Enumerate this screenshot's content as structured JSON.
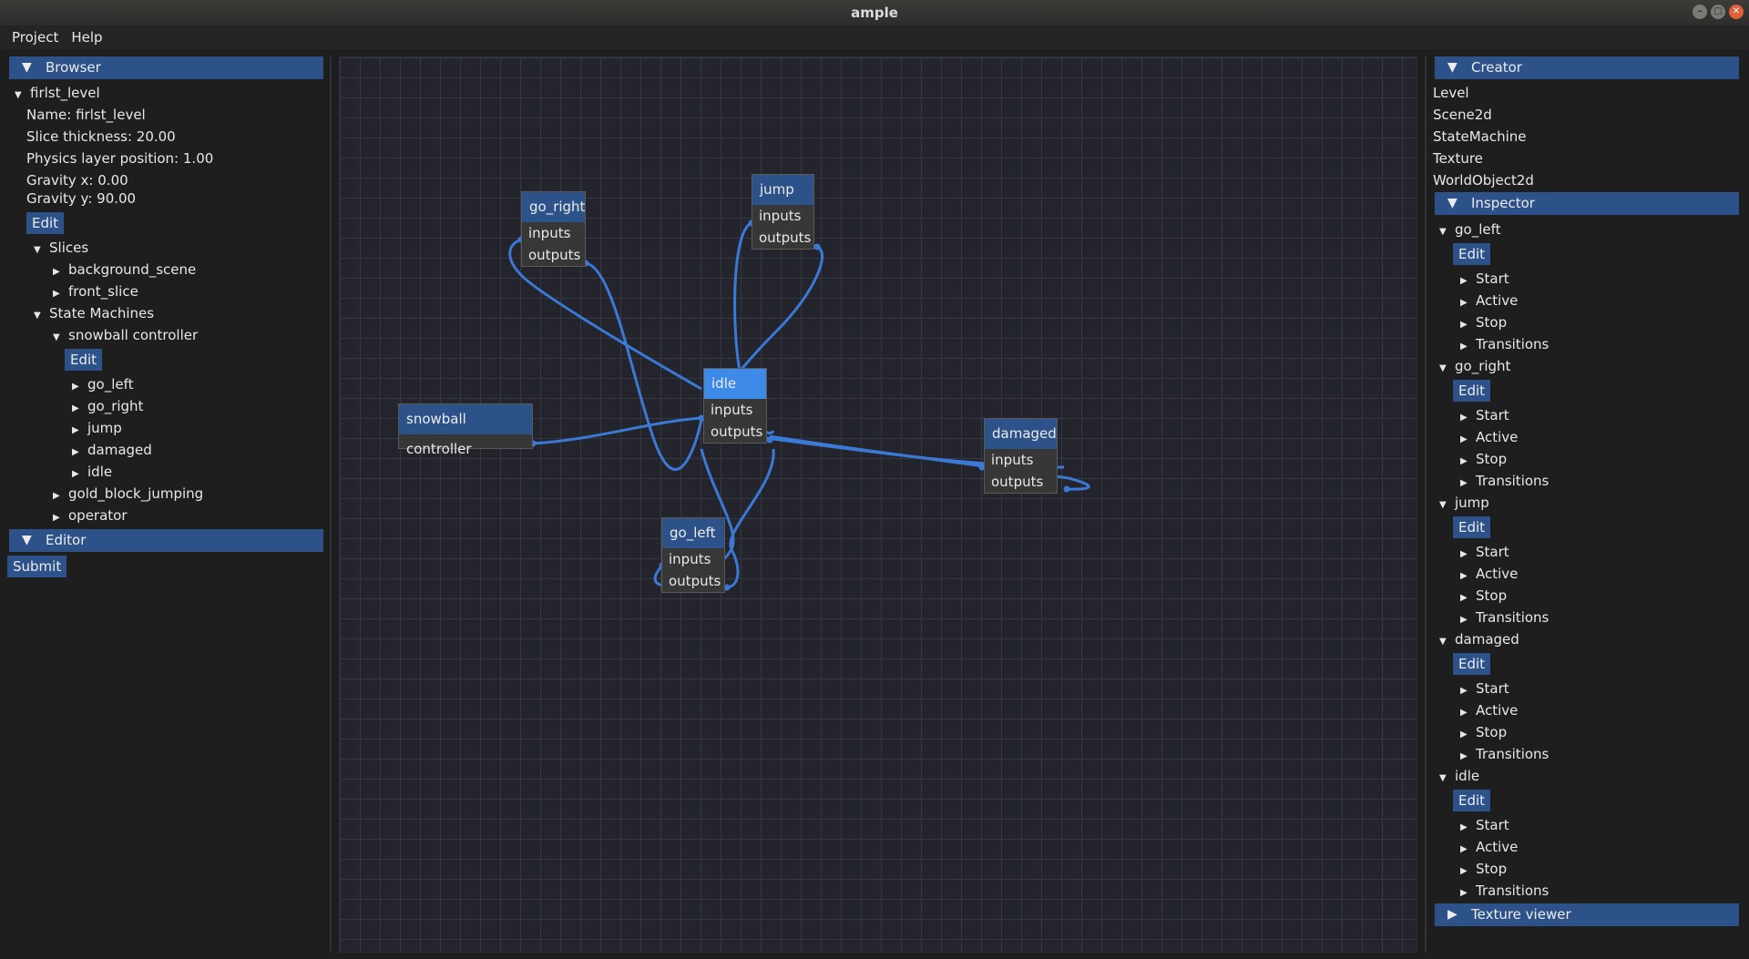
{
  "window": {
    "title": "ample"
  },
  "menu": {
    "items": [
      "Project",
      "Help"
    ]
  },
  "browser": {
    "header": "Browser",
    "level_name": "firlst_level",
    "props": [
      "Name: firlst_level",
      "Slice thickness: 20.00",
      "Physics layer position: 1.00",
      "Gravity x: 0.00",
      "Gravity y: 90.00"
    ],
    "edit_label": "Edit",
    "slices_label": "Slices",
    "slices": [
      "background_scene",
      "front_slice"
    ],
    "state_machines_label": "State Machines",
    "sm_name": "snowball controller",
    "sm_edit_label": "Edit",
    "sm_states": [
      "go_left",
      "go_right",
      "jump",
      "damaged",
      "idle"
    ],
    "other_sms": [
      "gold_block_jumping",
      "operator"
    ]
  },
  "editor": {
    "header": "Editor",
    "submit_label": "Submit"
  },
  "graph": {
    "nodes": [
      {
        "title": "go_right",
        "inputs": "inputs",
        "outputs": "outputs"
      },
      {
        "title": "jump",
        "inputs": "inputs",
        "outputs": "outputs"
      },
      {
        "title": "idle",
        "inputs": "inputs",
        "outputs": "outputs"
      },
      {
        "title": "snowball controller"
      },
      {
        "title": "damaged",
        "inputs": "inputs",
        "outputs": "outputs"
      },
      {
        "title": "go_left",
        "inputs": "inputs",
        "outputs": "outputs"
      }
    ],
    "wire_color": "#3a7ad6"
  },
  "creator": {
    "header": "Creator",
    "items": [
      "Level",
      "Scene2d",
      "StateMachine",
      "Texture",
      "WorldObject2d"
    ]
  },
  "inspector": {
    "header": "Inspector",
    "states": [
      {
        "name": "go_left",
        "edit": "Edit",
        "children": [
          "Start",
          "Active",
          "Stop",
          "Transitions"
        ]
      },
      {
        "name": "go_right",
        "edit": "Edit",
        "children": [
          "Start",
          "Active",
          "Stop",
          "Transitions"
        ]
      },
      {
        "name": "jump",
        "edit": "Edit",
        "children": [
          "Start",
          "Active",
          "Stop",
          "Transitions"
        ]
      },
      {
        "name": "damaged",
        "edit": "Edit",
        "children": [
          "Start",
          "Active",
          "Stop",
          "Transitions"
        ]
      },
      {
        "name": "idle",
        "edit": "Edit",
        "children": [
          "Start",
          "Active",
          "Stop",
          "Transitions"
        ]
      }
    ]
  },
  "texture_viewer": {
    "header": "Texture viewer"
  },
  "colors": {
    "accent": "#2c5289",
    "active_node": "#3d8ae8",
    "canvas_bg": "#23242c"
  }
}
